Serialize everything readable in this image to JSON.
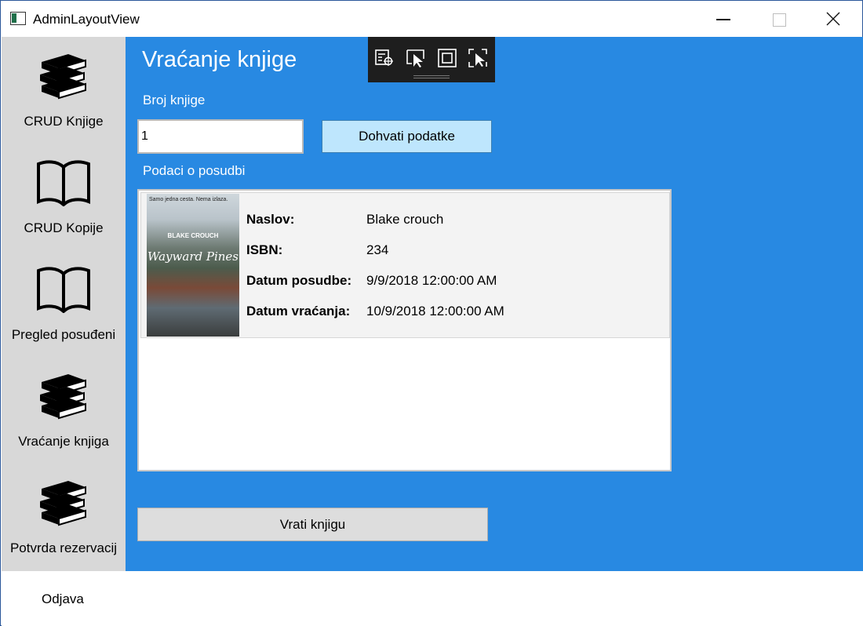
{
  "window": {
    "title": "AdminLayoutView"
  },
  "sidebar": {
    "items": [
      {
        "label": "CRUD Knjige",
        "icon": "books-icon"
      },
      {
        "label": "CRUD Kopije",
        "icon": "open-book-icon"
      },
      {
        "label": "Pregled posuđeni",
        "icon": "open-book-icon"
      },
      {
        "label": "Vraćanje knjiga",
        "icon": "books-icon"
      },
      {
        "label": "Potvrda rezervacij",
        "icon": "books-icon"
      }
    ]
  },
  "main": {
    "title": "Vraćanje knjige",
    "book_number_label": "Broj knjige",
    "book_number_value": "1",
    "fetch_button": "Dohvati podatke",
    "loan_info_label": "Podaci o posudbi",
    "loan": {
      "cover": {
        "tagline": "Samo jedna cesta. Nema izlaza.",
        "author": "BLAKE CROUCH",
        "title": "Wayward Pines"
      },
      "fields": [
        {
          "key": "Naslov:",
          "value": "Blake crouch"
        },
        {
          "key": "ISBN:",
          "value": "234"
        },
        {
          "key": "Datum posudbe:",
          "value": "9/9/2018 12:00:00 AM"
        },
        {
          "key": "Datum vraćanja:",
          "value": "10/9/2018 12:00:00 AM"
        }
      ]
    },
    "return_button": "Vrati knjigu"
  },
  "footer": {
    "logout": "Odjava"
  },
  "colors": {
    "main_bg": "#2889e2",
    "sidebar_bg": "#d8d8d8",
    "fetch_button_bg": "#bee6fd",
    "toolbar_bg": "#1e1e1e"
  },
  "debug_toolbar": {
    "icons": [
      "live-visual-tree-icon",
      "select-element-icon",
      "display-layout-adorners-icon",
      "track-focus-icon"
    ]
  }
}
